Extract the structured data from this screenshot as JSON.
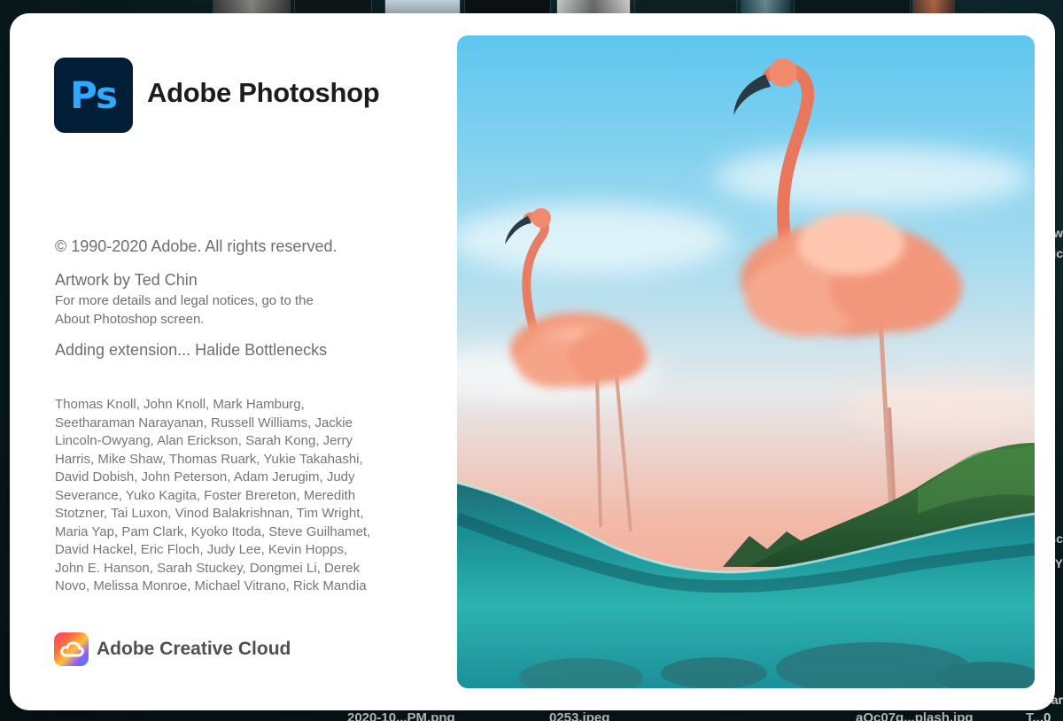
{
  "app": {
    "logo_text": "Ps",
    "title": "Adobe Photoshop",
    "brand_color": "#31a8ff",
    "logo_background": "#001e36"
  },
  "info": {
    "copyright": "© 1990-2020 Adobe. All rights reserved.",
    "artwork_credit": "Artwork by Ted Chin",
    "details_line1": "For more details and legal notices, go to the",
    "details_line2": "About Photoshop screen.",
    "status": "Adding extension... Halide Bottlenecks"
  },
  "credits": [
    "Thomas Knoll, John Knoll, Mark Hamburg,",
    "Seetharaman Narayanan, Russell Williams, Jackie",
    "Lincoln-Owyang, Alan Erickson, Sarah Kong, Jerry",
    "Harris, Mike Shaw, Thomas Ruark, Yukie Takahashi,",
    "David Dobish, John Peterson, Adam Jerugim, Judy",
    "Severance, Yuko Kagita, Foster Brereton, Meredith",
    "Stotzner, Tai Luxon, Vinod Balakrishnan, Tim Wright,",
    "Maria Yap, Pam Clark, Kyoko Itoda, Steve Guilhamet,",
    "David Hackel, Eric Floch, Judy Lee, Kevin Hopps,",
    "John E. Hanson, Sarah Stuckey, Dongmei Li, Derek",
    "Novo, Melissa Monroe, Michael Vitrano, Rick Mandia"
  ],
  "footer": {
    "brand": "Adobe Creative Cloud",
    "icon": "creative-cloud-icon"
  },
  "background": {
    "bottom_fragments": [
      "2020-10...PM.png",
      "0253.jpeg",
      "aQc07g...plash.jpg",
      "T...0"
    ],
    "edge_fragments": [
      "w",
      "ic",
      "sc",
      "Y",
      "Y",
      "ar"
    ]
  }
}
